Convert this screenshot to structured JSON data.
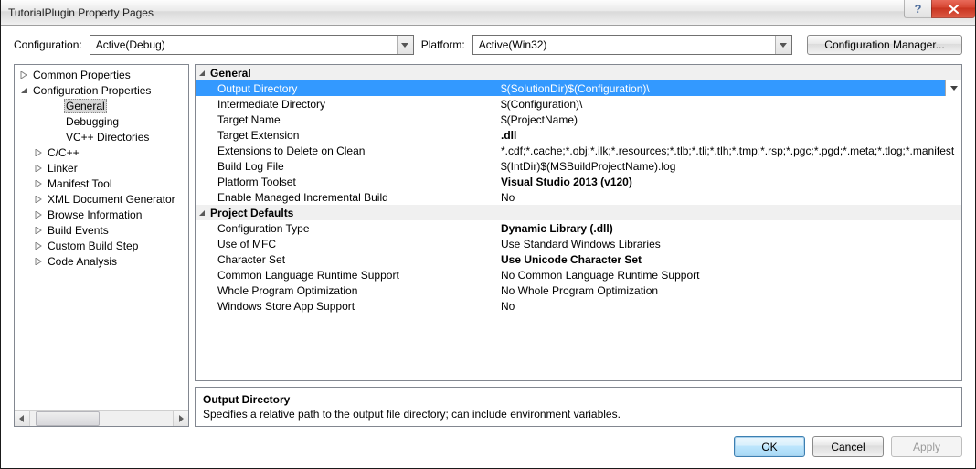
{
  "window": {
    "title": "TutorialPlugin Property Pages"
  },
  "toolbar": {
    "config_label": "Configuration:",
    "config_value": "Active(Debug)",
    "platform_label": "Platform:",
    "platform_value": "Active(Win32)",
    "config_manager": "Configuration Manager..."
  },
  "tree": {
    "items": [
      {
        "label": "Common Properties",
        "expanded": false,
        "level": 0,
        "expandable": true
      },
      {
        "label": "Configuration Properties",
        "expanded": true,
        "level": 0,
        "expandable": true
      },
      {
        "label": "General",
        "level": 2,
        "selected": true
      },
      {
        "label": "Debugging",
        "level": 2
      },
      {
        "label": "VC++ Directories",
        "level": 2
      },
      {
        "label": "C/C++",
        "expanded": false,
        "level": 1,
        "expandable": true
      },
      {
        "label": "Linker",
        "expanded": false,
        "level": 1,
        "expandable": true
      },
      {
        "label": "Manifest Tool",
        "expanded": false,
        "level": 1,
        "expandable": true
      },
      {
        "label": "XML Document Generator",
        "expanded": false,
        "level": 1,
        "expandable": true
      },
      {
        "label": "Browse Information",
        "expanded": false,
        "level": 1,
        "expandable": true
      },
      {
        "label": "Build Events",
        "expanded": false,
        "level": 1,
        "expandable": true
      },
      {
        "label": "Custom Build Step",
        "expanded": false,
        "level": 1,
        "expandable": true
      },
      {
        "label": "Code Analysis",
        "expanded": false,
        "level": 1,
        "expandable": true
      }
    ]
  },
  "grid": {
    "groups": [
      {
        "name": "General",
        "rows": [
          {
            "name": "Output Directory",
            "value": "$(SolutionDir)$(Configuration)\\",
            "selected": true,
            "dropdown": true
          },
          {
            "name": "Intermediate Directory",
            "value": "$(Configuration)\\"
          },
          {
            "name": "Target Name",
            "value": "$(ProjectName)"
          },
          {
            "name": "Target Extension",
            "value": ".dll",
            "bold": true
          },
          {
            "name": "Extensions to Delete on Clean",
            "value": "*.cdf;*.cache;*.obj;*.ilk;*.resources;*.tlb;*.tli;*.tlh;*.tmp;*.rsp;*.pgc;*.pgd;*.meta;*.tlog;*.manifest"
          },
          {
            "name": "Build Log File",
            "value": "$(IntDir)$(MSBuildProjectName).log"
          },
          {
            "name": "Platform Toolset",
            "value": "Visual Studio 2013 (v120)",
            "bold": true
          },
          {
            "name": "Enable Managed Incremental Build",
            "value": "No"
          }
        ]
      },
      {
        "name": "Project Defaults",
        "rows": [
          {
            "name": "Configuration Type",
            "value": "Dynamic Library (.dll)",
            "bold": true
          },
          {
            "name": "Use of MFC",
            "value": "Use Standard Windows Libraries"
          },
          {
            "name": "Character Set",
            "value": "Use Unicode Character Set",
            "bold": true
          },
          {
            "name": "Common Language Runtime Support",
            "value": "No Common Language Runtime Support"
          },
          {
            "name": "Whole Program Optimization",
            "value": "No Whole Program Optimization"
          },
          {
            "name": "Windows Store App Support",
            "value": "No"
          }
        ]
      }
    ]
  },
  "description": {
    "title": "Output Directory",
    "text": "Specifies a relative path to the output file directory; can include environment variables."
  },
  "buttons": {
    "ok": "OK",
    "cancel": "Cancel",
    "apply": "Apply"
  }
}
